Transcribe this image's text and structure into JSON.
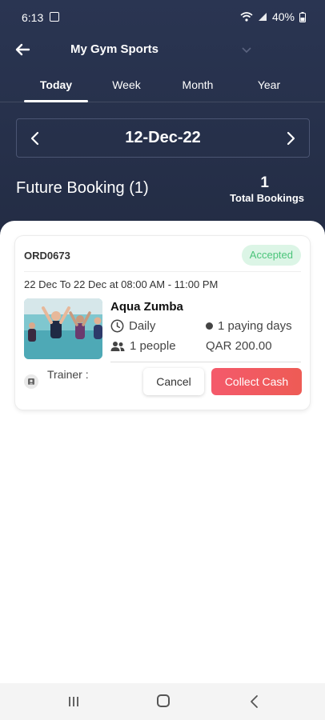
{
  "status_bar": {
    "time": "6:13",
    "battery": "40%"
  },
  "app_bar": {
    "title": "My Gym Sports"
  },
  "tabs": [
    {
      "label": "Today",
      "active": true
    },
    {
      "label": "Week",
      "active": false
    },
    {
      "label": "Month",
      "active": false
    },
    {
      "label": "Year",
      "active": false
    }
  ],
  "date_nav": {
    "date": "12-Dec-22"
  },
  "summary": {
    "title": "Future Booking (1)",
    "total_count": "1",
    "total_label": "Total Bookings"
  },
  "booking": {
    "order_id": "ORD0673",
    "status": "Accepted",
    "date_range": "22 Dec To 22 Dec at 08:00 AM - 11:00 PM",
    "class_name": "Aqua Zumba",
    "frequency": "Daily",
    "paying_days": "1 paying days",
    "people": "1 people",
    "price": "QAR 200.00",
    "trainer_label": "Trainer :",
    "cancel_label": "Cancel",
    "collect_label": "Collect Cash"
  },
  "colors": {
    "header": "#26304a",
    "accepted_bg": "#dcf5e6",
    "accepted_text": "#4bc47a",
    "collect_button": "#f25a63"
  },
  "icons": {
    "back": "arrow-left-icon",
    "chevron": "chevron-down-icon",
    "prev": "chevron-left-icon",
    "next": "chevron-right-icon",
    "clock": "clock-icon",
    "people": "people-icon",
    "trainer": "avatar-icon"
  }
}
